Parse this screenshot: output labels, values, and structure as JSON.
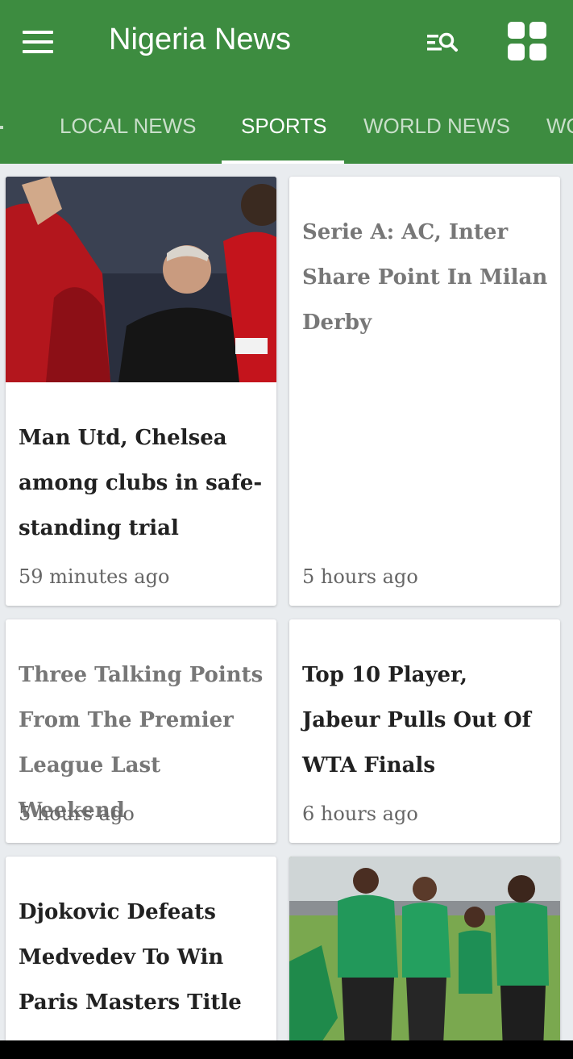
{
  "app": {
    "title": "Nigeria News"
  },
  "tabs": [
    {
      "label": "LOCAL NEWS"
    },
    {
      "label": "SPORTS"
    },
    {
      "label": "WORLD NEWS"
    },
    {
      "label": "WO"
    }
  ],
  "active_tab": "SPORTS",
  "colors": {
    "primary": "#3d8c40",
    "background": "#e9ecef",
    "headline": "#212121",
    "headline_muted": "#777777",
    "timestamp": "#666666"
  },
  "icons": {
    "menu": "menu-icon",
    "search_list": "search-list-icon",
    "grid": "grid-view-icon"
  },
  "articles": [
    {
      "headline": "Man Utd, Chelsea among clubs in safe-standing trial",
      "time": "59 minutes ago",
      "image": "football-players-celebrating"
    },
    {
      "headline": "Serie A: AC, Inter Share Point In Milan Derby",
      "time": "5 hours ago"
    },
    {
      "headline": "Three Talking Points From The Premier League Last Weekend",
      "time": "5 hours ago"
    },
    {
      "headline": "Top 10 Player, Jabeur Pulls Out Of WTA Finals",
      "time": "6 hours ago"
    },
    {
      "headline": "Djokovic Defeats Medvedev To Win Paris Masters Title",
      "time": ""
    },
    {
      "headline": "",
      "time": "",
      "image": "team-training-on-pitch"
    }
  ]
}
